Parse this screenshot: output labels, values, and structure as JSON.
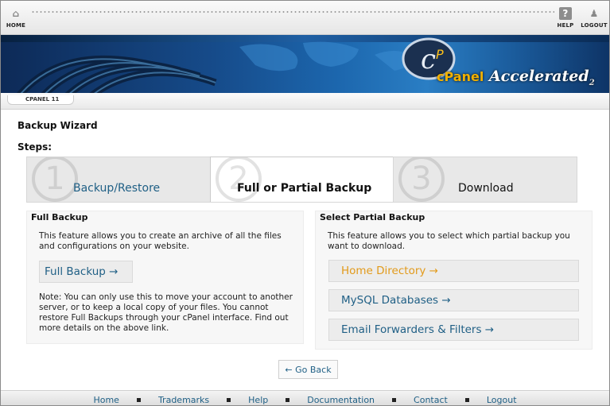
{
  "topnav": {
    "home_label": "HOME",
    "help_label": "HELP",
    "logout_label": "LOGOUT",
    "home_icon": "home-icon",
    "help_icon": "help-icon",
    "logout_icon": "logout-icon"
  },
  "banner": {
    "logo_text": "cPanel",
    "logo_suffix": "Accelerated",
    "logo_version": "2"
  },
  "breadcrumb": {
    "label": "CPANEL 11"
  },
  "page": {
    "title": "Backup Wizard",
    "steps_label": "Steps:"
  },
  "steps": [
    {
      "number": "1",
      "label": "Backup/Restore",
      "active": false
    },
    {
      "number": "2",
      "label": "Full or Partial Backup",
      "active": true
    },
    {
      "number": "3",
      "label": "Download",
      "active": false
    }
  ],
  "full_backup": {
    "heading": "Full Backup",
    "description": "This feature allows you to create an archive of all the files and configurations on your website.",
    "button_label": "Full Backup →",
    "note": "Note: You can only use this to move your account to another server, or to keep a local copy of your files. You cannot restore Full Backups through your cPanel interface. Find out more details on the above link."
  },
  "partial_backup": {
    "heading": "Select Partial Backup",
    "description": "This feature allows you to select which partial backup you want to download.",
    "options": [
      {
        "label": "Home Directory →"
      },
      {
        "label": "MySQL Databases →"
      },
      {
        "label": "Email Forwarders & Filters →"
      }
    ]
  },
  "go_back_label": "← Go Back",
  "footer": {
    "links": [
      "Home",
      "Trademarks",
      "Help",
      "Documentation",
      "Contact",
      "Logout"
    ]
  },
  "colors": {
    "link": "#1f5f85",
    "highlight": "#e29a1a",
    "banner": "#164b8a"
  }
}
